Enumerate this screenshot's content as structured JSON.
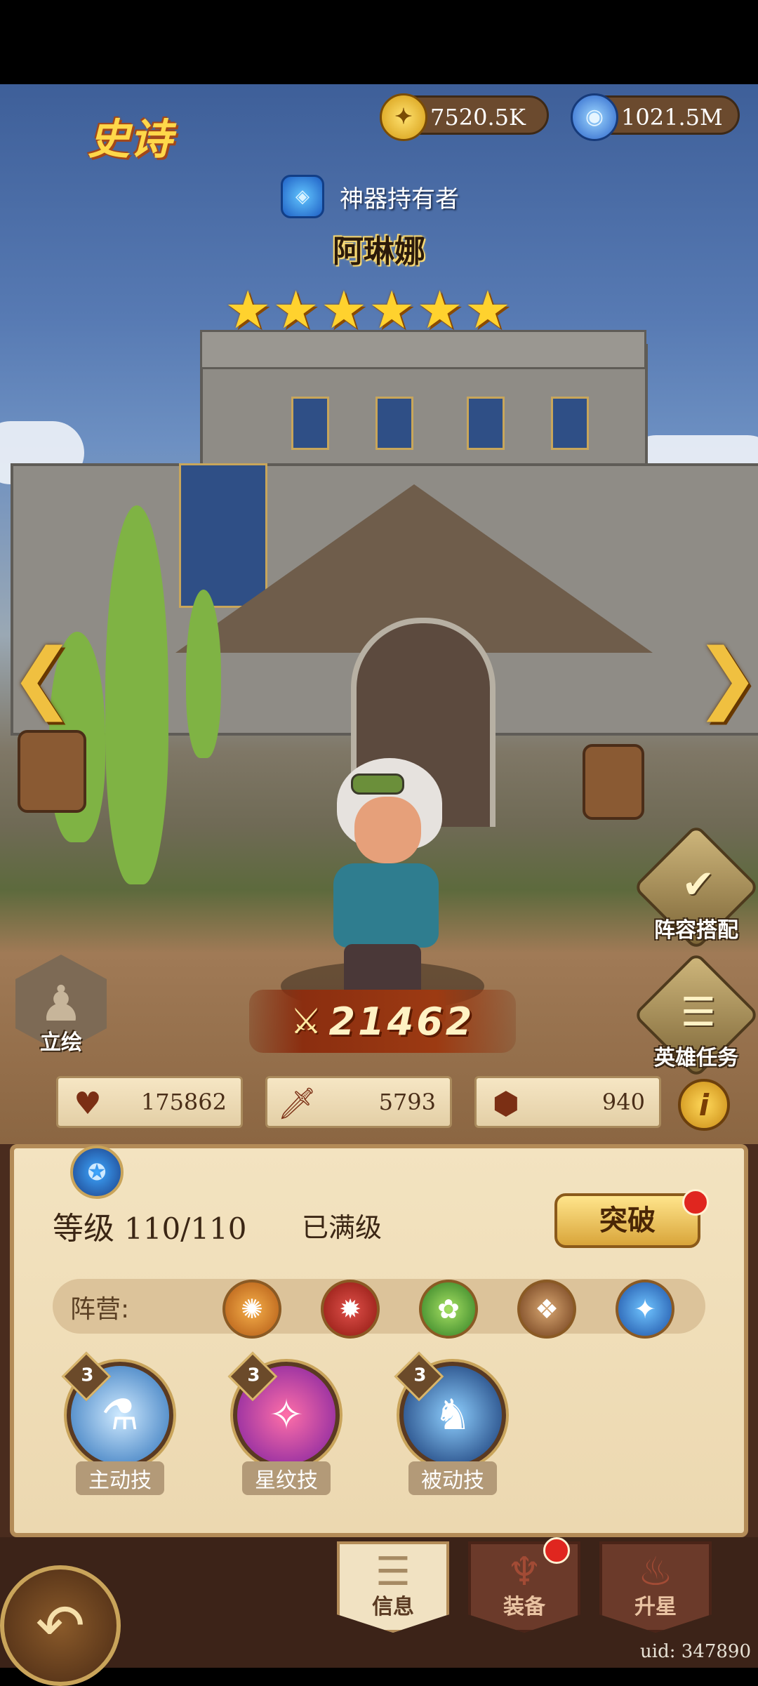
{
  "header": {
    "rarity": "史诗",
    "gold": "7520.5K",
    "mana": "1021.5M",
    "hero_title": "神器持有者",
    "hero_name": "阿琳娜",
    "stars": 6
  },
  "side": {
    "lineup_label": "阵容搭配",
    "quest_label": "英雄任务",
    "portrait_label": "立绘"
  },
  "power": {
    "value": "21462"
  },
  "stats": {
    "hp": "175862",
    "attack": "5793",
    "defense": "940"
  },
  "panel": {
    "level_label": "等级",
    "level_value": "110/110",
    "max_label": "已满级",
    "breakthrough_label": "突破",
    "faction_label": "阵营:",
    "skills": [
      {
        "level": "3",
        "name": "主动技"
      },
      {
        "level": "3",
        "name": "星纹技"
      },
      {
        "level": "3",
        "name": "被动技"
      }
    ]
  },
  "tabs": [
    {
      "label": "信息"
    },
    {
      "label": "装备"
    },
    {
      "label": "升星"
    }
  ],
  "uid": "uid: 347890",
  "icons": {
    "gold": "gold-coin-icon",
    "mana": "mana-potion-icon",
    "gem": "artifact-gem-icon"
  },
  "colors": {
    "gold_text": "#ffd84a",
    "panel_bg": "#f3e3c0",
    "accent_red": "#e0261f"
  }
}
